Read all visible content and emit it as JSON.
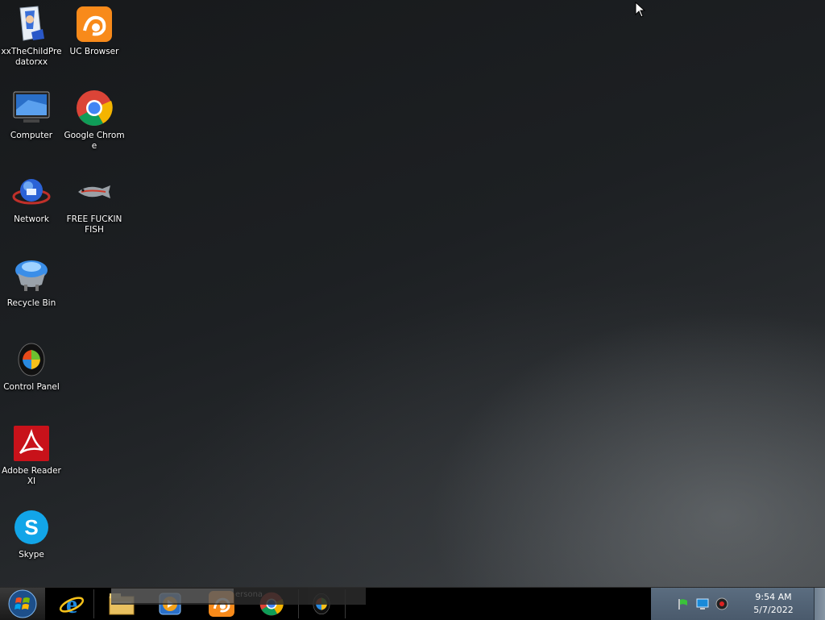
{
  "desktop_icons": [
    {
      "id": "user-folder",
      "label": "xxTheChildPredatorxx",
      "icon": "user-folder-icon"
    },
    {
      "id": "uc-browser",
      "label": "UC Browser",
      "icon": "uc-browser-icon"
    },
    {
      "id": "computer",
      "label": "Computer",
      "icon": "computer-icon"
    },
    {
      "id": "google-chrome",
      "label": "Google Chrome",
      "icon": "chrome-icon"
    },
    {
      "id": "network",
      "label": "Network",
      "icon": "network-icon"
    },
    {
      "id": "free-fish",
      "label": "FREE FUCKIN FISH",
      "icon": "fish-icon"
    },
    {
      "id": "recycle-bin",
      "label": "Recycle Bin",
      "icon": "recycle-bin-icon"
    },
    {
      "id": "control-panel",
      "label": "Control Panel",
      "icon": "control-panel-icon"
    },
    {
      "id": "adobe-reader",
      "label": "Adobe Reader XI",
      "icon": "adobe-reader-icon"
    },
    {
      "id": "skype",
      "label": "Skype",
      "icon": "skype-icon"
    }
  ],
  "taskbar": {
    "start": "start-orb-icon",
    "pinned": [
      "internet-explorer-icon",
      "file-explorer-icon",
      "media-player-icon",
      "uc-browser-icon",
      "chrome-icon",
      "control-panel-icon"
    ],
    "hover_preview_text": "ersona"
  },
  "tray": {
    "icons": [
      "action-center-flag-icon",
      "network-monitor-icon",
      "volume-icon"
    ],
    "time": "9:54 AM",
    "date": "5/7/2022"
  },
  "colors": {
    "taskbar": "#000000",
    "tray": "#56687a",
    "desktop": "#1d2023"
  }
}
